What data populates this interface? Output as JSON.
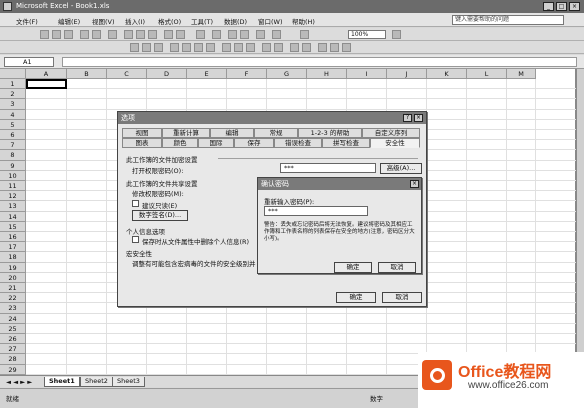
{
  "window": {
    "title": "Microsoft Excel - Book1.xls"
  },
  "menu": {
    "items": [
      "文件(F)",
      "编辑(E)",
      "视图(V)",
      "插入(I)",
      "格式(O)",
      "工具(T)",
      "数据(D)",
      "窗口(W)",
      "帮助(H)"
    ],
    "help_placeholder": "键入需要帮助的问题"
  },
  "toolbar": {
    "zoom": "100%"
  },
  "formula": {
    "name_box": "A1",
    "content": ""
  },
  "grid": {
    "columns": [
      "A",
      "B",
      "C",
      "D",
      "E",
      "F",
      "G",
      "H",
      "I",
      "J",
      "K",
      "L",
      "M"
    ],
    "rows": [
      "1",
      "2",
      "3",
      "4",
      "5",
      "6",
      "7",
      "8",
      "9",
      "10",
      "11",
      "12",
      "13",
      "14",
      "15",
      "16",
      "17",
      "18",
      "19",
      "20",
      "21",
      "22",
      "23",
      "24",
      "25",
      "26",
      "27",
      "28",
      "29"
    ]
  },
  "sheets": [
    "Sheet1",
    "Sheet2",
    "Sheet3"
  ],
  "status": {
    "left": "就绪",
    "right": "数字"
  },
  "options_dialog": {
    "title": "选项",
    "tabs_row1": [
      "视图",
      "重新计算",
      "编辑",
      "常规",
      "1-2-3 的帮助",
      "自定义序列"
    ],
    "tabs_row2": [
      "图表",
      "颜色",
      "国际",
      "保存",
      "错误检查",
      "拼写检查",
      "安全性"
    ],
    "section_open": "此工作簿的文件加密设置",
    "open_password_label": "打开权限密码(O):",
    "open_password_value": "***",
    "advanced_button": "高级(A)...",
    "section_share": "此工作簿的文件共享设置",
    "modify_password_label": "修改权限密码(M):",
    "readonly_label": "建议只读(E)",
    "digital_sign_button": "数字签名(D)...",
    "section_privacy": "个人信息选项",
    "privacy_check_label": "保存时从文件属性中删除个人信息(R)",
    "section_macro": "宏安全性",
    "macro_text": "调整有可能包含宏病毒的文件的安全级别并",
    "ok": "确定",
    "cancel": "取消"
  },
  "confirm_dialog": {
    "title": "确认密码",
    "label": "重新输入密码(P):",
    "value": "***",
    "warning": "警告：丢失或忘记密码后将无法恢复。建议将密码及其相应工作簿和工作表名称的列表保存在安全的地方(注意，密码区分大小写)。",
    "ok": "确定",
    "cancel": "取消"
  },
  "watermark": {
    "brand": "Office教程网",
    "url": "www.office26.com"
  },
  "colors": {
    "titlebar": "#6b6b6b",
    "brand": "#e8561c"
  }
}
